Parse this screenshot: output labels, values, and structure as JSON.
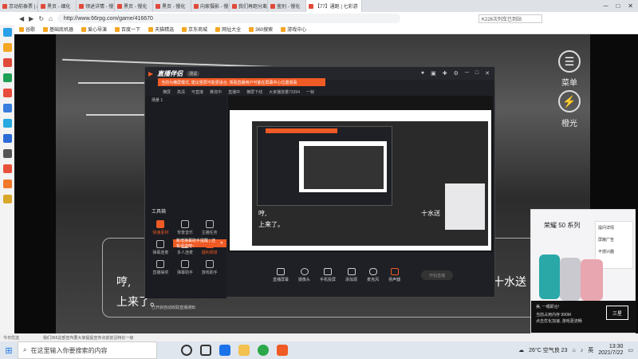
{
  "browser": {
    "tabs": [
      {
        "label": "京动前泰票 | 最长高计"
      },
      {
        "label": "黑页 - 细化"
      },
      {
        "label": "领述详情 - 慢化6BRG"
      },
      {
        "label": "黑页 - 慢化"
      },
      {
        "label": "黑页 - 慢化"
      },
      {
        "label": "向家摄影 - 慢化6BRG"
      },
      {
        "label": "我们再跑分离影景 - 慢化"
      },
      {
        "label": "鉴别 - 慢化"
      },
      {
        "label": "【77】通跑 | 七彩游"
      }
    ],
    "url": "http://www.66rpg.com/game/416670",
    "search_text": "K226次列车已到站",
    "bookmarks": [
      "谷歌",
      "基础底机器",
      "爱心导演",
      "百度一下",
      "天猫精选",
      "京东商城",
      "网址大全",
      "360搜索",
      "游戏中心"
    ]
  },
  "video": {
    "menu_label": "菜单",
    "hide_label": "橙光",
    "subtitle_left_1": "哼,",
    "subtitle_left_2": "上来了。",
    "subtitle_right": "十水送",
    "inner_subtitle_1": "哼,",
    "inner_subtitle_2": "上来了。",
    "inner_subtitle_3": "十水送"
  },
  "app": {
    "logo": "直播伴侣",
    "beta": "测试",
    "banner": "当前为横屏模式, 建议竖屏可能更适合, 观看直播用户可能在屏幕中心位置观看",
    "sub_items": [
      "横屏",
      "高清",
      "可直接",
      "推流中",
      "直播中",
      "横屏下线",
      "大家播放量73394",
      "一帧"
    ],
    "viewer_count": "73394",
    "scene_label": "场景 1",
    "tools_title": "工具箱",
    "tools": [
      {
        "label": "快速素材",
        "orange": true
      },
      {
        "label": "背景音乐",
        "orange": false
      },
      {
        "label": "主播任务",
        "orange": false
      },
      {
        "label": "弹幕连麦",
        "orange": false
      },
      {
        "label": "多人连麦",
        "orange": false
      },
      {
        "label": "福利频道",
        "orange": true
      },
      {
        "label": "直播抽奖",
        "orange": false
      },
      {
        "label": "弹幕助手",
        "orange": false
      },
      {
        "label": "游戏助手",
        "orange": false
      }
    ],
    "tooltip": "新增弹幕助手提醒 | 还有话说吧~",
    "notice": "已开启自动收取直播通知",
    "bottom_buttons": [
      "直播屏幕",
      "摄像头",
      "手机投屏",
      "添加源",
      "麦克风",
      "扬声器"
    ],
    "start_label": "开始直播"
  },
  "ad": {
    "title": "荣耀 50 系列",
    "menu": [
      "提问详情",
      "屏蔽广告",
      "不感兴趣"
    ],
    "line1": "美, 一眼即合!",
    "line2": "当前占用内存 990M",
    "line3": "点击优化加速, 游戏更流畅",
    "logo": "三星"
  },
  "statusbar": {
    "left": "今日优选",
    "middle": "我们365总部宣布要大家提提宣传点前前沿特长一级"
  },
  "taskbar": {
    "search_placeholder": "在这里输入你要搜索的内容",
    "weather": "26°C 空气良 23",
    "ime": "英",
    "time": "13:30",
    "date": "2021/7/22"
  }
}
